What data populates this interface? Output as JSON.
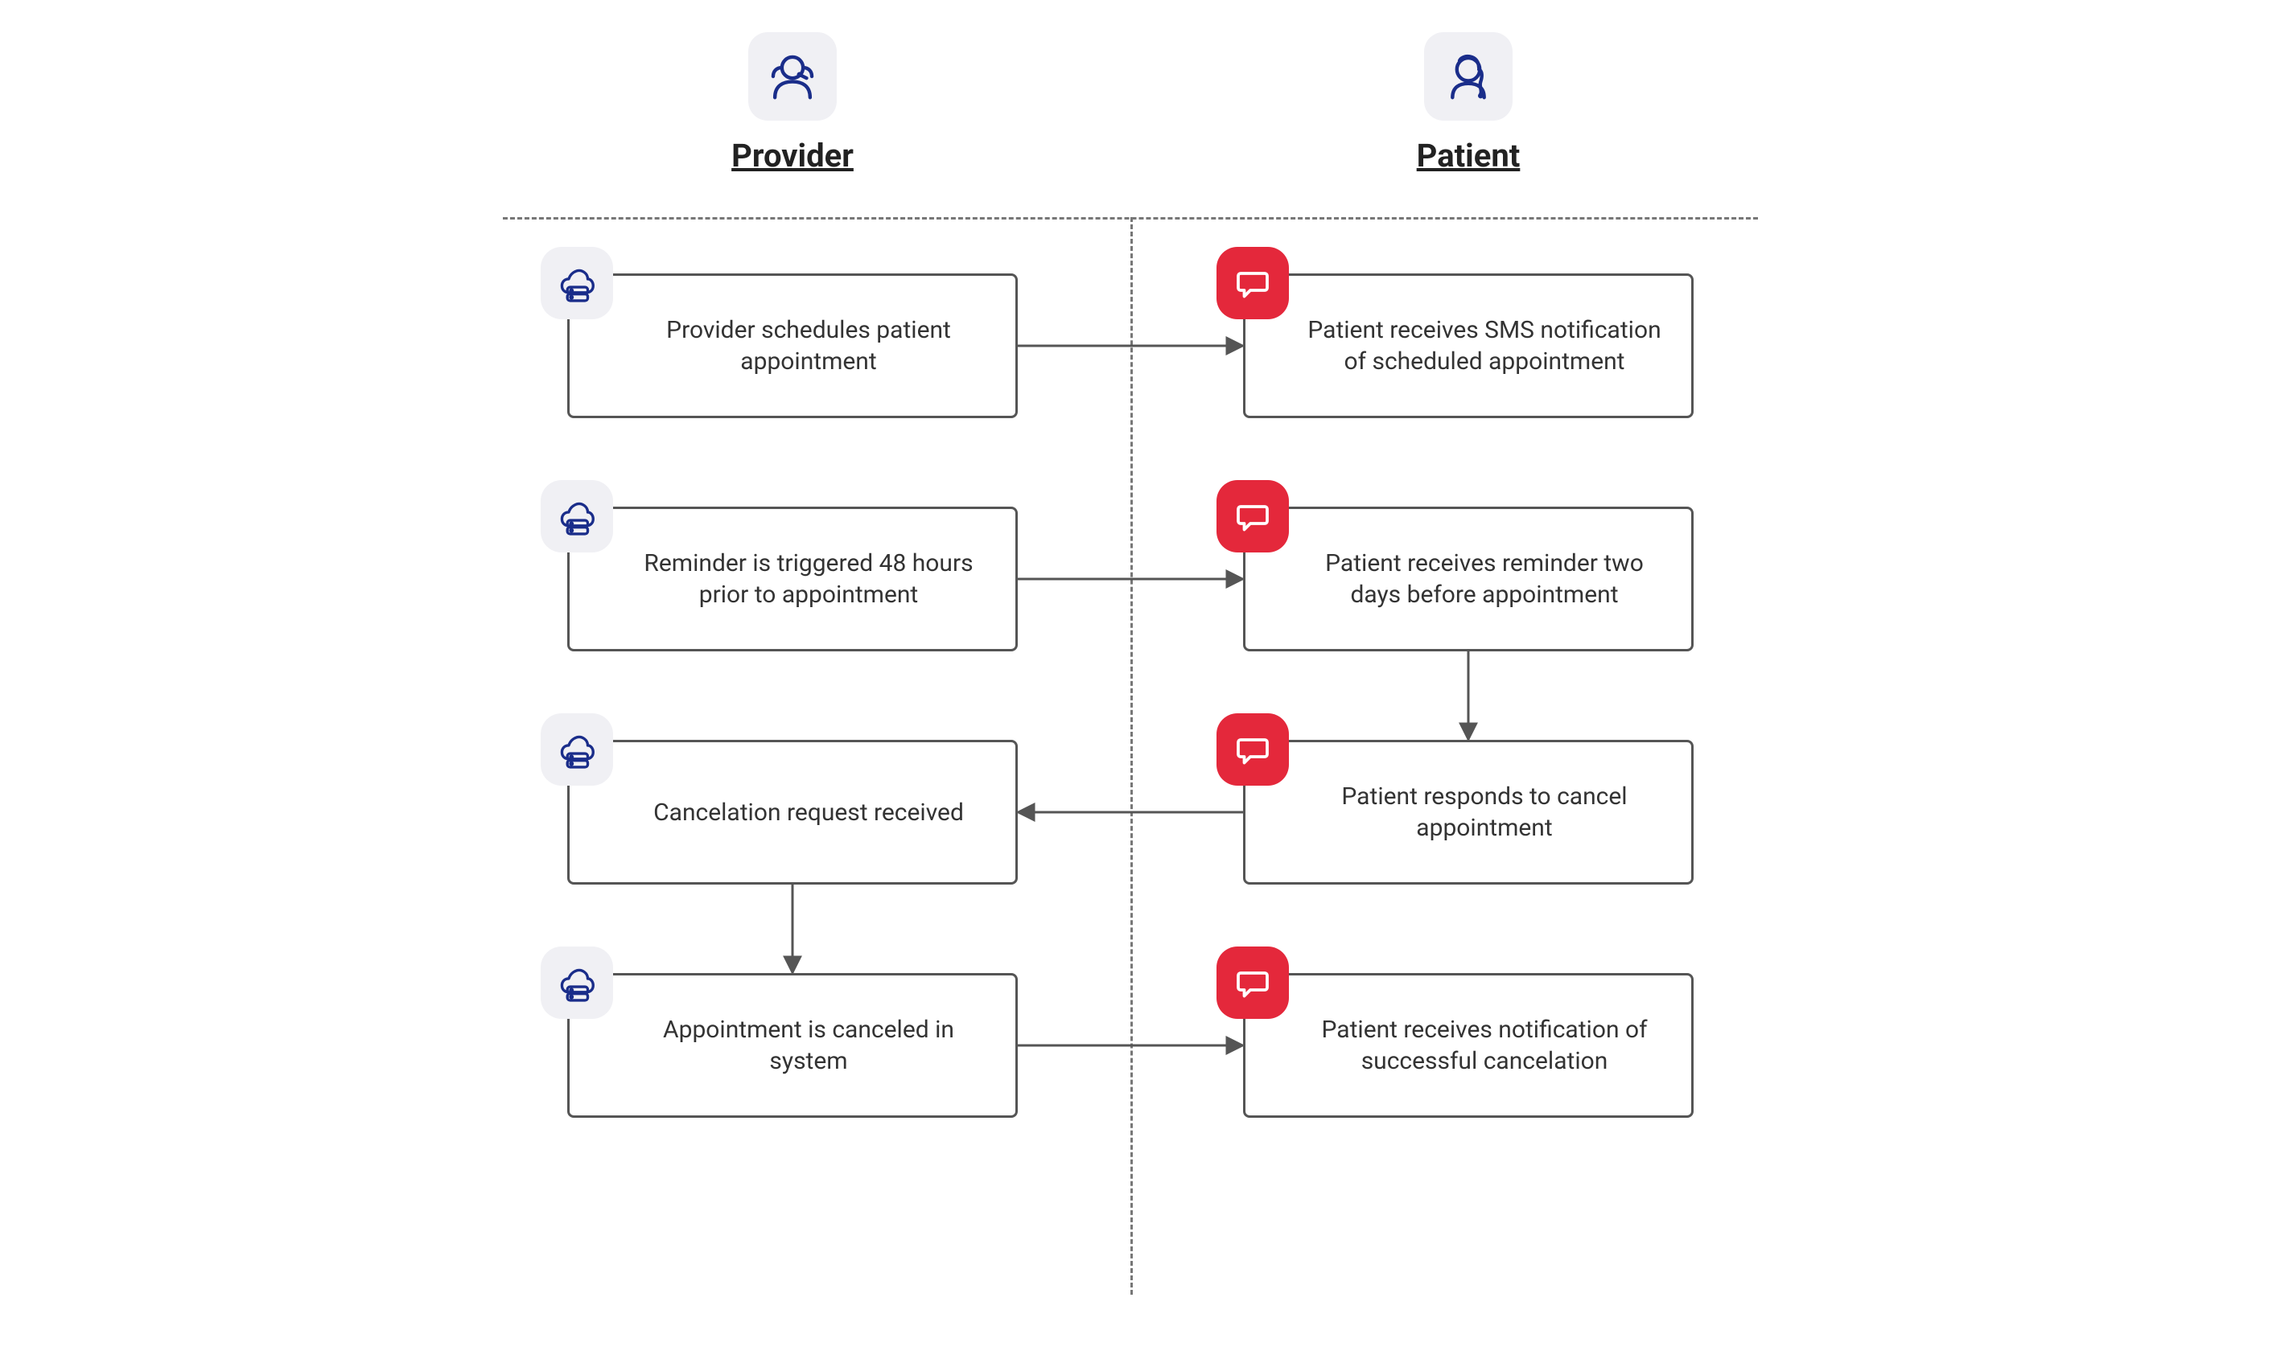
{
  "columns": {
    "provider": {
      "label": "Provider"
    },
    "patient": {
      "label": "Patient"
    }
  },
  "nodes": {
    "p1": "Provider schedules patient appointment",
    "p2": "Reminder is triggered 48 hours prior to appointment",
    "p3": "Cancelation request received",
    "p4": "Appointment is canceled in system",
    "q1": "Patient receives SMS notification of scheduled appointment",
    "q2": "Patient receives reminder two days before appointment",
    "q3": "Patient responds to cancel appointment",
    "q4": "Patient receives notification of successful cancelation"
  },
  "colors": {
    "node_border": "#555555",
    "dash": "#777777",
    "provider_icon": "#1a2d8a",
    "patient_icon": "#1a2d8a",
    "cloud_badge_bg": "#f0f0f4",
    "chat_badge_bg": "#e4283b",
    "chat_badge_fg": "#ffffff",
    "arrow": "#555555"
  },
  "arrows": [
    {
      "from": "p1",
      "to": "q1",
      "dir": "right"
    },
    {
      "from": "p2",
      "to": "q2",
      "dir": "right"
    },
    {
      "from": "q2",
      "to": "q3",
      "dir": "down"
    },
    {
      "from": "q3",
      "to": "p3",
      "dir": "left"
    },
    {
      "from": "p3",
      "to": "p4",
      "dir": "down"
    },
    {
      "from": "p4",
      "to": "q4",
      "dir": "right"
    }
  ]
}
